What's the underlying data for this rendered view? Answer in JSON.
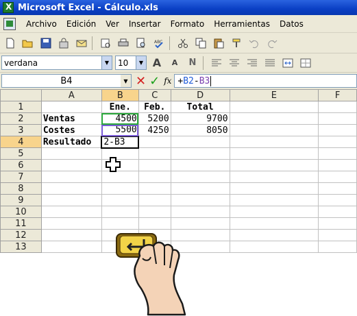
{
  "window": {
    "title": "Microsoft Excel - Cálculo.xls"
  },
  "menu": [
    "Archivo",
    "Edición",
    "Ver",
    "Insertar",
    "Formato",
    "Herramientas",
    "Datos"
  ],
  "format_toolbar": {
    "font": "verdana",
    "size": "10"
  },
  "formula_bar": {
    "cell_ref": "B4",
    "formula": {
      "prefix": "+",
      "ref1": "B2",
      "op": "-",
      "ref2": "B3"
    }
  },
  "sheet": {
    "columns": [
      "A",
      "B",
      "C",
      "D",
      "E",
      "F"
    ],
    "rows": [
      "1",
      "2",
      "3",
      "4",
      "5",
      "6",
      "7",
      "8",
      "9",
      "10",
      "11",
      "12",
      "13"
    ],
    "cells": {
      "b1": "Ene.",
      "c1": "Feb.",
      "d1": "Total",
      "a2": "Ventas",
      "b2": "4500",
      "c2": "5200",
      "d2": "9700",
      "a3": "Costes",
      "b3": "5500",
      "c3": "4250",
      "d3": "8050",
      "a4": "Resultado",
      "b4": "2-B3"
    }
  },
  "colors": {
    "ref_b2": "#2aa83a",
    "ref_b3": "#7b5cd6",
    "cancel": "#d42020",
    "ok": "#19a019"
  },
  "icons": [
    "new-icon",
    "open-icon",
    "save-icon",
    "permission-icon",
    "print-icon",
    "print-preview-icon",
    "spelling-icon",
    "cut-icon",
    "copy-icon",
    "paste-icon",
    "format-painter-icon",
    "bold-icon",
    "align-left-icon",
    "align-center-icon",
    "align-right-icon",
    "justify-icon",
    "merge-icon",
    "border-icon",
    "enter-key-icon",
    "hand-icon",
    "cross-cursor-icon"
  ]
}
